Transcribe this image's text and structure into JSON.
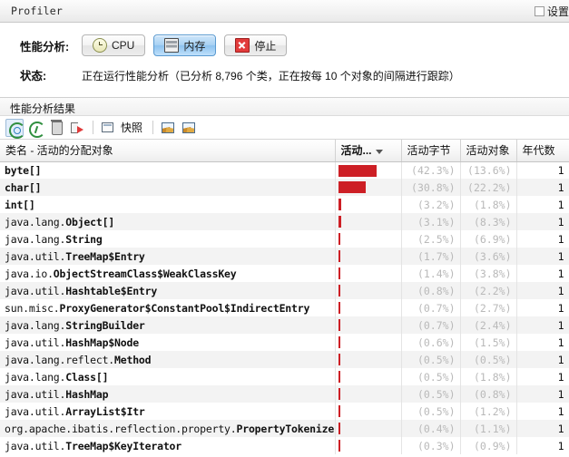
{
  "window": {
    "title": "Profiler",
    "settings_label": "设置",
    "settings_checked": false
  },
  "profile": {
    "label": "性能分析:",
    "buttons": [
      {
        "label": "CPU",
        "icon": "cpu-icon",
        "selected": false
      },
      {
        "label": "内存",
        "icon": "memory-icon",
        "selected": true
      },
      {
        "label": "停止",
        "icon": "stop-icon",
        "selected": false
      }
    ]
  },
  "status": {
    "label": "状态:",
    "text": "正在运行性能分析（已分析 8,796 个类，正在按每 10 个对象的间隔进行跟踪）"
  },
  "results": {
    "header": "性能分析结果",
    "toolbar": [
      {
        "name": "rerun-icon",
        "label": "",
        "active": true
      },
      {
        "name": "refresh-icon",
        "label": "",
        "active": false
      },
      {
        "name": "trash-icon",
        "label": "",
        "active": false
      },
      {
        "name": "export-icon",
        "label": "",
        "active": false
      },
      {
        "name": "snapshot-icon",
        "label": "快照",
        "active": false
      },
      {
        "name": "heapdump-image-icon",
        "label": "",
        "active": false
      },
      {
        "name": "heapdump-compare-icon",
        "label": "",
        "active": false
      }
    ]
  },
  "table": {
    "columns": [
      {
        "key": "cls",
        "label": "类名 - 活动的分配对象",
        "sorted": false
      },
      {
        "key": "bar",
        "label": "活动...",
        "sorted": true,
        "sort_dir": "desc"
      },
      {
        "key": "bytes",
        "label": "活动字节",
        "sorted": false
      },
      {
        "key": "objects",
        "label": "活动对象",
        "sorted": false
      },
      {
        "key": "gen",
        "label": "年代数",
        "sorted": false
      }
    ],
    "rows": [
      {
        "pkg": "",
        "cls": "byte[]",
        "bar_pct": 42.3,
        "bytes": "(42.3%)",
        "objects": "(13.6%)",
        "gen": "1"
      },
      {
        "pkg": "",
        "cls": "char[]",
        "bar_pct": 30.8,
        "bytes": "(30.8%)",
        "objects": "(22.2%)",
        "gen": "1"
      },
      {
        "pkg": "",
        "cls": "int[]",
        "bar_pct": 3.2,
        "bytes": "(3.2%)",
        "objects": "(1.8%)",
        "gen": "1"
      },
      {
        "pkg": "java.lang.",
        "cls": "Object[]",
        "bar_pct": 3.1,
        "bytes": "(3.1%)",
        "objects": "(8.3%)",
        "gen": "1"
      },
      {
        "pkg": "java.lang.",
        "cls": "String",
        "bar_pct": 2.5,
        "bytes": "(2.5%)",
        "objects": "(6.9%)",
        "gen": "1"
      },
      {
        "pkg": "java.util.",
        "cls": "TreeMap$Entry",
        "bar_pct": 1.7,
        "bytes": "(1.7%)",
        "objects": "(3.6%)",
        "gen": "1"
      },
      {
        "pkg": "java.io.",
        "cls": "ObjectStreamClass$WeakClassKey",
        "bar_pct": 1.4,
        "bytes": "(1.4%)",
        "objects": "(3.8%)",
        "gen": "1"
      },
      {
        "pkg": "java.util.",
        "cls": "Hashtable$Entry",
        "bar_pct": 0.8,
        "bytes": "(0.8%)",
        "objects": "(2.2%)",
        "gen": "1"
      },
      {
        "pkg": "sun.misc.",
        "cls": "ProxyGenerator$ConstantPool$IndirectEntry",
        "bar_pct": 0.7,
        "bytes": "(0.7%)",
        "objects": "(2.7%)",
        "gen": "1"
      },
      {
        "pkg": "java.lang.",
        "cls": "StringBuilder",
        "bar_pct": 0.7,
        "bytes": "(0.7%)",
        "objects": "(2.4%)",
        "gen": "1"
      },
      {
        "pkg": "java.util.",
        "cls": "HashMap$Node",
        "bar_pct": 0.6,
        "bytes": "(0.6%)",
        "objects": "(1.5%)",
        "gen": "1"
      },
      {
        "pkg": "java.lang.reflect.",
        "cls": "Method",
        "bar_pct": 0.5,
        "bytes": "(0.5%)",
        "objects": "(0.5%)",
        "gen": "1"
      },
      {
        "pkg": "java.lang.",
        "cls": "Class[]",
        "bar_pct": 0.5,
        "bytes": "(0.5%)",
        "objects": "(1.8%)",
        "gen": "1"
      },
      {
        "pkg": "java.util.",
        "cls": "HashMap",
        "bar_pct": 0.5,
        "bytes": "(0.5%)",
        "objects": "(0.8%)",
        "gen": "1"
      },
      {
        "pkg": "java.util.",
        "cls": "ArrayList$Itr",
        "bar_pct": 0.5,
        "bytes": "(0.5%)",
        "objects": "(1.2%)",
        "gen": "1"
      },
      {
        "pkg": "org.apache.ibatis.reflection.property.",
        "cls": "PropertyTokenizer",
        "bar_pct": 0.4,
        "bytes": "(0.4%)",
        "objects": "(1.1%)",
        "gen": "1"
      },
      {
        "pkg": "java.util.",
        "cls": "TreeMap$KeyIterator",
        "bar_pct": 0.3,
        "bytes": "(0.3%)",
        "objects": "(0.9%)",
        "gen": "1"
      }
    ]
  },
  "colors": {
    "bar": "#cd1f25",
    "accent_selected": "#8cc2ef",
    "pct_text": "#b9b9b9"
  }
}
